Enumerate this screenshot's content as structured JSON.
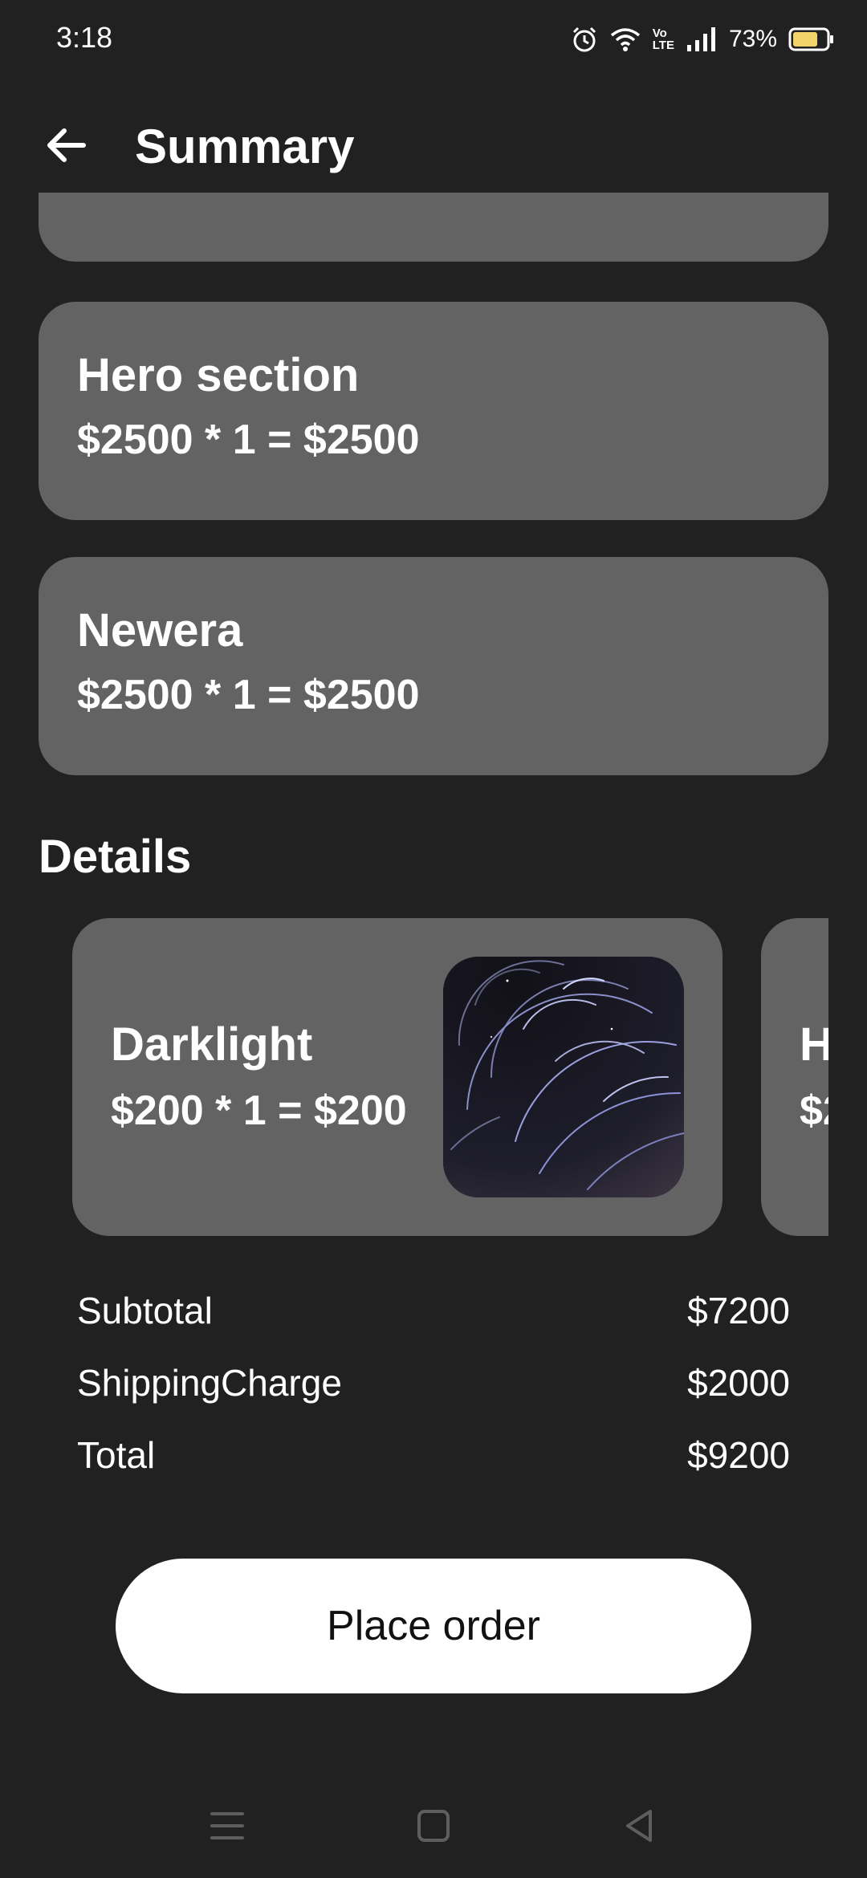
{
  "status_bar": {
    "time": "3:18",
    "battery_percent": "73%",
    "icons": [
      "alarm-icon",
      "wifi-icon",
      "volte-icon",
      "signal-icon",
      "battery-icon"
    ],
    "volte_label_top": "Vo",
    "volte_label_bottom": "LTE"
  },
  "app_bar": {
    "title": "Summary",
    "back_icon": "arrow-left-icon"
  },
  "order_items": [
    {
      "name": "Hero section",
      "calculation": "$2500 * 1 = $2500"
    },
    {
      "name": "Newera",
      "calculation": "$2500 * 1 = $2500"
    }
  ],
  "details": {
    "title": "Details",
    "products": [
      {
        "name": "Darklight",
        "calculation": "$200 * 1 = $200",
        "image": "star-trails-photo"
      },
      {
        "name": "H",
        "calculation": "$2"
      }
    ]
  },
  "totals": {
    "subtotal_label": "Subtotal",
    "subtotal_value": "$7200",
    "shipping_label": "ShippingCharge",
    "shipping_value": "$2000",
    "total_label": "Total",
    "total_value": "$9200"
  },
  "actions": {
    "place_order_label": "Place order"
  },
  "navigation": {
    "icons": [
      "menu-icon",
      "home-square-icon",
      "back-triangle-icon"
    ]
  },
  "colors": {
    "background": "#212121",
    "card": "#636363",
    "button": "#ffffff",
    "battery_fill": "#f2d46b"
  }
}
